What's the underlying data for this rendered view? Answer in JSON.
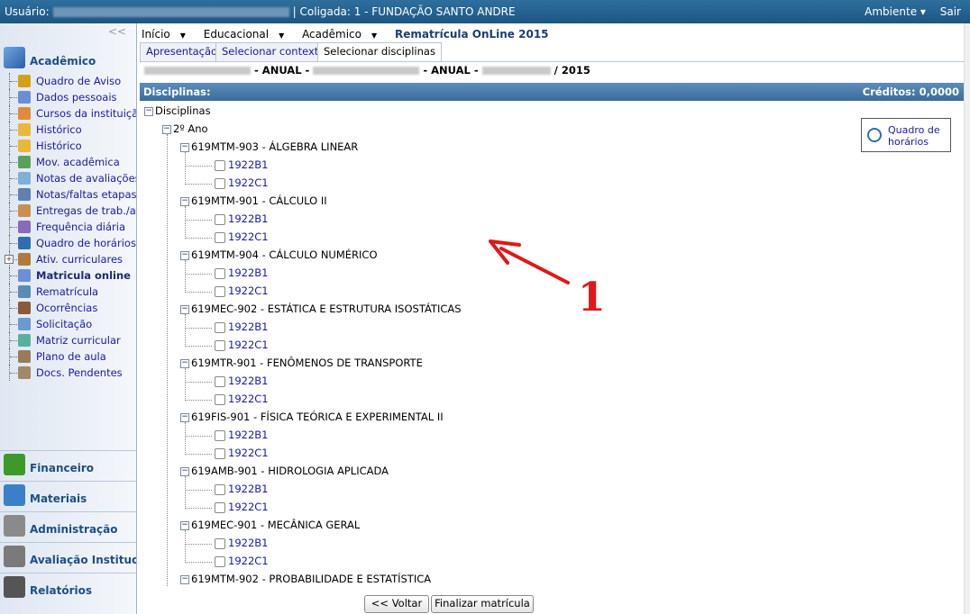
{
  "topbar": {
    "user_label": "Usuário:",
    "coligada": "| Coligada: 1 - FUNDAÇÃO SANTO ANDRE",
    "ambiente": "Ambiente ▾",
    "sair": "Sair"
  },
  "sidebar": {
    "collapse": "<<",
    "academic_title": "Acadêmico",
    "items": [
      {
        "label": "Quadro de Aviso",
        "icon": "search-icon"
      },
      {
        "label": "Dados pessoais",
        "icon": "person-icon"
      },
      {
        "label": "Cursos da instituição",
        "icon": "courses-icon"
      },
      {
        "label": "Histórico",
        "icon": "pencil-icon"
      },
      {
        "label": "Histórico",
        "icon": "pencil-icon"
      },
      {
        "label": "Mov. acadêmica",
        "icon": "arrow-icon"
      },
      {
        "label": "Notas de avaliações",
        "icon": "grades-icon"
      },
      {
        "label": "Notas/faltas etapas",
        "icon": "list-icon"
      },
      {
        "label": "Entregas de trab./av",
        "icon": "box-icon"
      },
      {
        "label": "Frequência diária",
        "icon": "calendar-icon"
      },
      {
        "label": "Quadro de horários",
        "icon": "clock-icon"
      },
      {
        "label": "Ativ. curriculares",
        "icon": "activity-icon"
      },
      {
        "label": "Matricula online",
        "icon": "enroll-icon"
      },
      {
        "label": "Rematrícula",
        "icon": "reenroll-icon"
      },
      {
        "label": "Ocorrências",
        "icon": "occurrence-icon"
      },
      {
        "label": "Solicitação",
        "icon": "request-icon"
      },
      {
        "label": "Matriz curricular",
        "icon": "matrix-icon"
      },
      {
        "label": "Plano de aula",
        "icon": "book-icon"
      },
      {
        "label": "Docs. Pendentes",
        "icon": "docs-icon"
      }
    ],
    "sections": [
      {
        "title": "Financeiro",
        "icon": "money-icon",
        "color": "#3c9a2a"
      },
      {
        "title": "Materiais",
        "icon": "folder-icon",
        "color": "#3a7fc9"
      },
      {
        "title": "Administração",
        "icon": "wrench-icon",
        "color": "#8a8a8a"
      },
      {
        "title": "Avaliação Institucional",
        "icon": "evaluation-icon",
        "color": "#7a7a7a"
      },
      {
        "title": "Relatórios",
        "icon": "report-icon",
        "color": "#555555"
      }
    ]
  },
  "nav": {
    "inicio": "Início",
    "educacional": "Educacional",
    "academico": "Acadêmico",
    "title": "Rematrícula OnLine 2015"
  },
  "tabs": [
    "Apresentação",
    "Selecionar contexto",
    "Selecionar disciplinas"
  ],
  "context": {
    "part1": "- ANUAL -",
    "part2": "- ANUAL -",
    "part3": "/ 2015"
  },
  "band": {
    "left": "Disciplinas:",
    "right": "Créditos: 0,0000"
  },
  "tree": {
    "root": "Disciplinas",
    "year": "2º Ano",
    "disciplines": [
      {
        "name": "619MTM-903 - ÁLGEBRA LINEAR",
        "classes": [
          "1922B1",
          "1922C1"
        ]
      },
      {
        "name": "619MTM-901 - CÁLCULO II",
        "classes": [
          "1922B1",
          "1922C1"
        ]
      },
      {
        "name": "619MTM-904 - CÁLCULO NUMÉRICO",
        "classes": [
          "1922B1",
          "1922C1"
        ]
      },
      {
        "name": "619MEC-902 - ESTÁTICA E ESTRUTURA ISOSTÁTICAS",
        "classes": [
          "1922B1",
          "1922C1"
        ]
      },
      {
        "name": "619MTR-901 - FENÔMENOS DE TRANSPORTE",
        "classes": [
          "1922B1",
          "1922C1"
        ]
      },
      {
        "name": "619FIS-901 - FÍSICA TEÓRICA E EXPERIMENTAL II",
        "classes": [
          "1922B1",
          "1922C1"
        ]
      },
      {
        "name": "619AMB-901 - HIDROLOGIA APLICADA",
        "classes": [
          "1922B1",
          "1922C1"
        ]
      },
      {
        "name": "619MEC-901 - MECÂNICA GERAL",
        "classes": [
          "1922B1",
          "1922C1"
        ]
      },
      {
        "name": "619MTM-902 - PROBABILIDADE E ESTATÍSTICA",
        "classes": []
      }
    ]
  },
  "quadro": {
    "line1": "Quadro de",
    "line2": "horários"
  },
  "buttons": {
    "back": "<< Voltar",
    "finish": "Finalizar matrícula"
  },
  "annotation": {
    "label": "1",
    "color": "#e01818"
  }
}
